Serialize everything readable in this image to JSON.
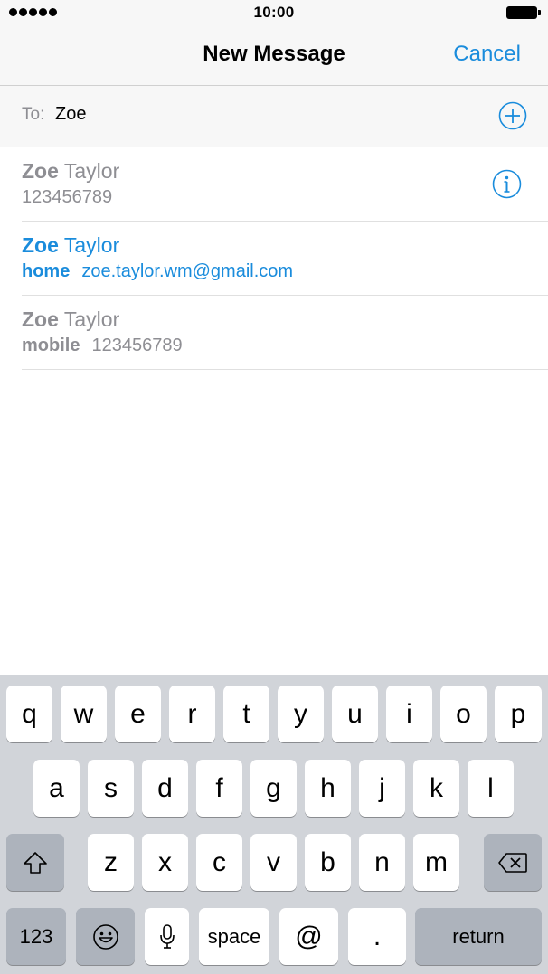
{
  "status": {
    "time": "10:00"
  },
  "nav": {
    "title": "New Message",
    "cancel": "Cancel"
  },
  "to": {
    "label": "To:",
    "value": "Zoe"
  },
  "results": [
    {
      "first": "Zoe",
      "last": "Taylor",
      "type": "",
      "value": "123456789",
      "highlighted": false,
      "has_info": true
    },
    {
      "first": "Zoe",
      "last": "Taylor",
      "type": "home",
      "value": "zoe.taylor.wm@gmail.com",
      "highlighted": true,
      "has_info": false
    },
    {
      "first": "Zoe",
      "last": "Taylor",
      "type": "mobile",
      "value": "123456789",
      "highlighted": false,
      "has_info": false
    }
  ],
  "keyboard": {
    "row1": [
      "q",
      "w",
      "e",
      "r",
      "t",
      "y",
      "u",
      "i",
      "o",
      "p"
    ],
    "row2": [
      "a",
      "s",
      "d",
      "f",
      "g",
      "h",
      "j",
      "k",
      "l"
    ],
    "row3": [
      "z",
      "x",
      "c",
      "v",
      "b",
      "n",
      "m"
    ],
    "numbers": "123",
    "space": "space",
    "at": "@",
    "dot": ".",
    "return": "return"
  },
  "colors": {
    "accent": "#1a8cdc",
    "secondary_text": "#8e8e93",
    "keyboard_bg": "#d1d4d9",
    "function_key": "#adb3bc"
  },
  "icons": {
    "add": "plus-circle-icon",
    "info": "info-circle-icon",
    "shift": "shift-arrow-icon",
    "delete": "backspace-icon",
    "emoji": "emoji-icon",
    "mic": "microphone-icon"
  }
}
